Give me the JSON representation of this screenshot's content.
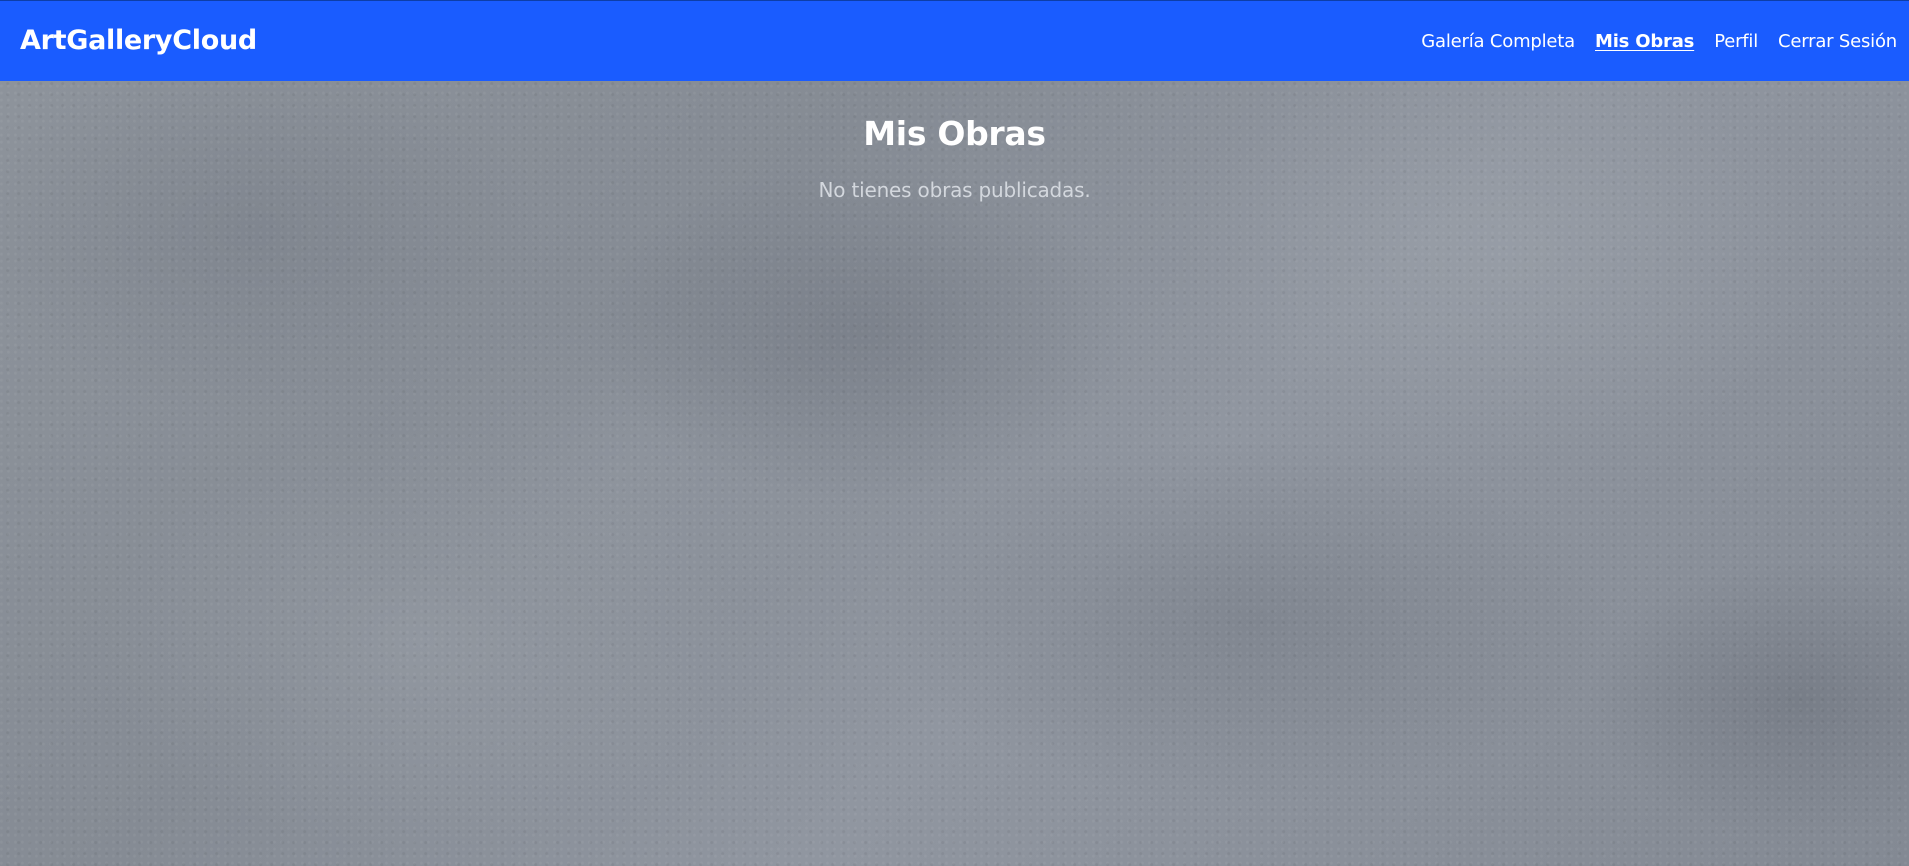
{
  "navbar": {
    "brand": "ArtGalleryCloud",
    "color": "#1a5cff",
    "links": [
      {
        "label": "Galería Completa",
        "active": false
      },
      {
        "label": "Mis Obras",
        "active": true
      },
      {
        "label": "Perfil",
        "active": false
      },
      {
        "label": "Cerrar Sesión",
        "active": false
      }
    ]
  },
  "main": {
    "title": "Mis Obras",
    "empty_message": "No tienes obras publicadas."
  }
}
